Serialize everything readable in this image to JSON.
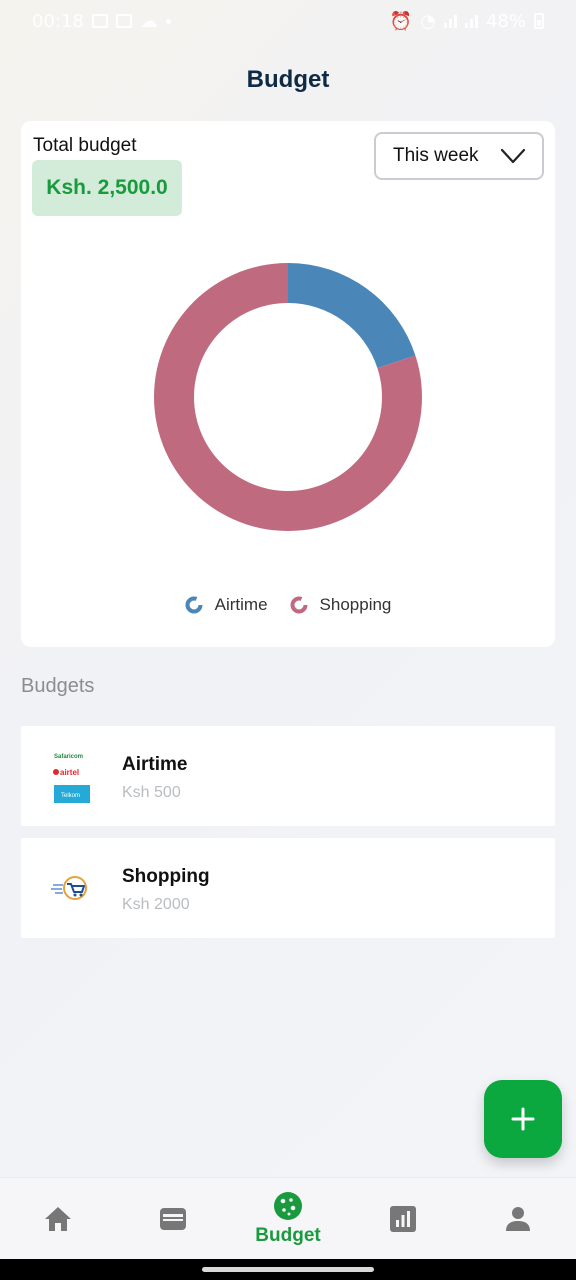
{
  "status_bar": {
    "time": "00:18",
    "battery": "48%"
  },
  "header": {
    "title": "Budget"
  },
  "summary": {
    "total_label": "Total budget",
    "total_value": "Ksh. 2,500.0",
    "period": "This week"
  },
  "chart_data": {
    "type": "pie",
    "title": "",
    "labels": [
      "Airtime",
      "Shopping"
    ],
    "values": [
      500,
      2000
    ],
    "colors": [
      "#4b86b9",
      "#c06a80"
    ],
    "legend_position": "bottom"
  },
  "budgets_section": {
    "title": "Budgets",
    "items": [
      {
        "name": "Airtime",
        "amount": "Ksh 500",
        "icon": "airtime-providers-logo"
      },
      {
        "name": "Shopping",
        "amount": "Ksh 2000",
        "icon": "shopping-cart-logo"
      }
    ]
  },
  "fab": {
    "icon": "plus-icon"
  },
  "bottom_nav": {
    "items": [
      {
        "icon": "home-icon",
        "label": ""
      },
      {
        "icon": "wallet-icon",
        "label": ""
      },
      {
        "icon": "budget-cookie-icon",
        "label": "Budget",
        "active": true
      },
      {
        "icon": "stats-icon",
        "label": ""
      },
      {
        "icon": "profile-icon",
        "label": ""
      }
    ]
  },
  "colors": {
    "accent_green": "#0aa83f",
    "title_navy": "#0f2a44"
  }
}
